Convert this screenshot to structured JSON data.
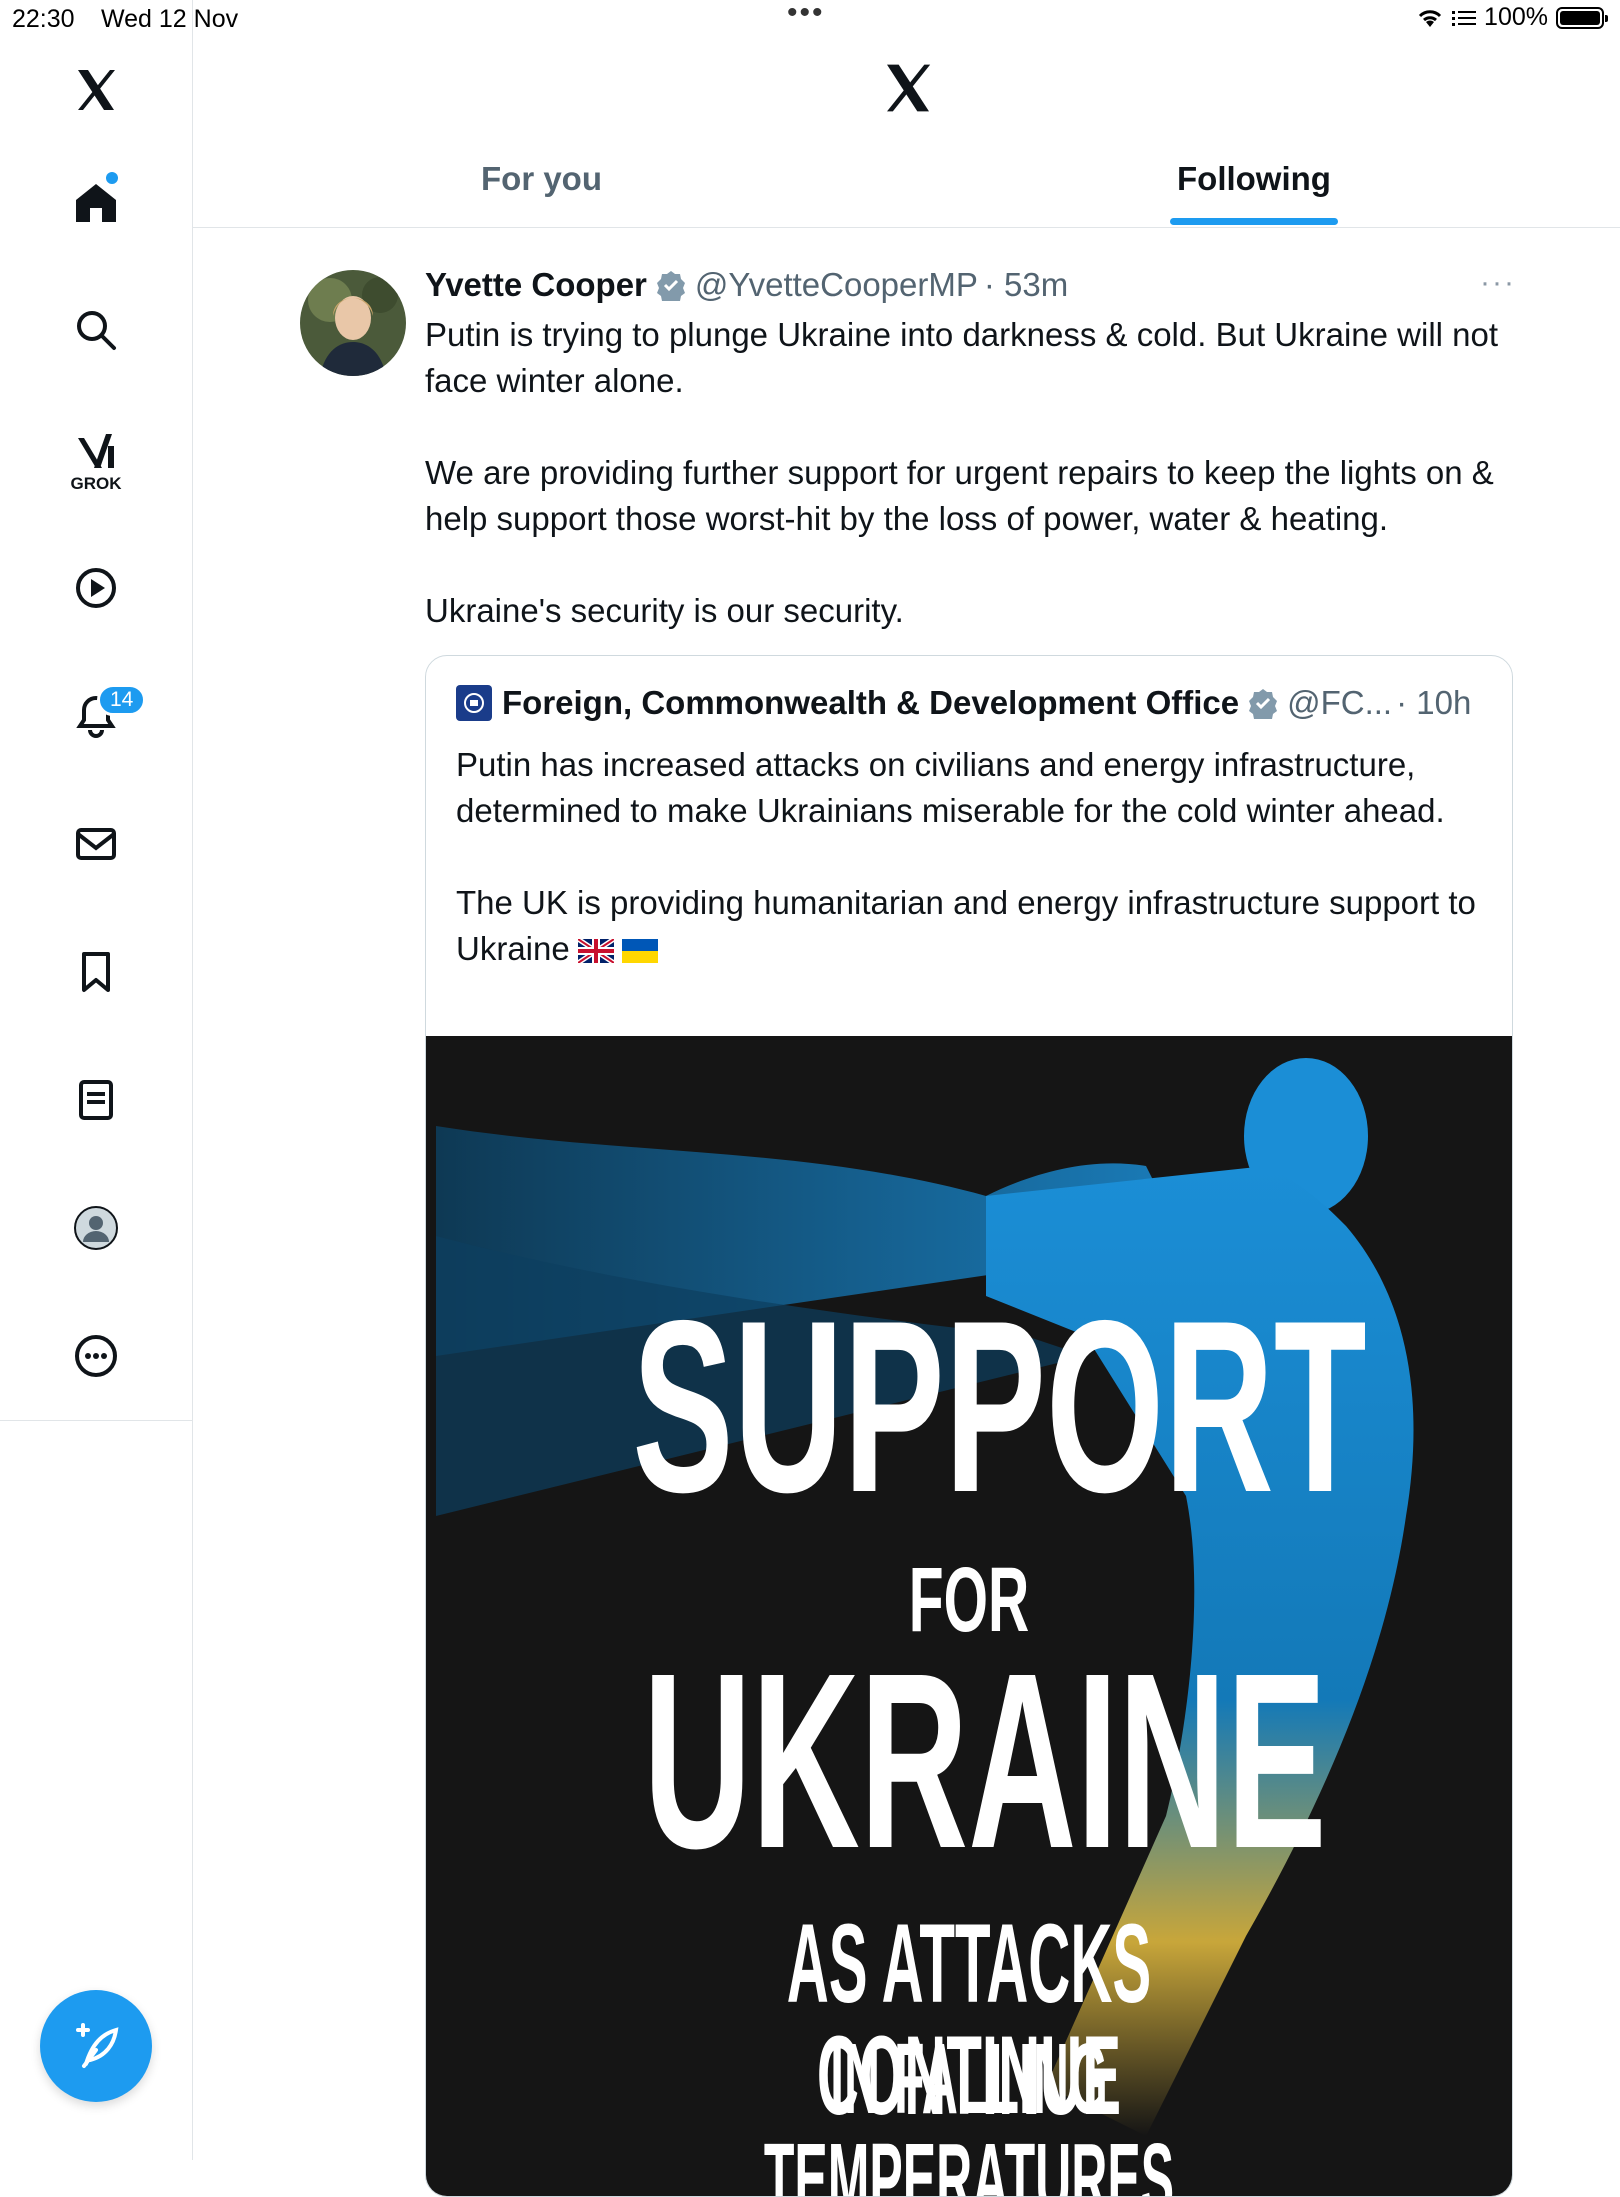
{
  "status_bar": {
    "time": "22:30",
    "date": "Wed 12 Nov",
    "battery": "100%"
  },
  "sidebar": {
    "items": [
      "x-logo",
      "home-icon",
      "search-icon",
      "grok-icon",
      "video-icon",
      "notifications-icon",
      "messages-icon",
      "bookmarks-icon",
      "lists-icon",
      "profile-icon",
      "more-icon"
    ],
    "grok_label": "GROK",
    "notifications_count": "14"
  },
  "tabs": {
    "for_you": "For you",
    "following": "Following",
    "active": "Following"
  },
  "tweet": {
    "name": "Yvette Cooper",
    "handle": "@YvetteCooperMP",
    "time": "· 53m",
    "text": [
      "Putin is trying to plunge Ukraine into darkness & cold. But Ukraine will not face winter alone.",
      "We are providing further support for urgent repairs to keep the lights on & help support those worst-hit by the loss of power, water & heating.",
      "Ukraine's security is our security."
    ],
    "more": "···"
  },
  "quote": {
    "name": "Foreign, Commonwealth & Development Office",
    "handle": "@FC...",
    "time": "· 10h",
    "text": [
      "Putin has increased attacks on civilians and energy infrastructure, determined to make Ukrainians miserable for the cold winter ahead.",
      "The UK is providing humanitarian and energy infrastructure support to Ukraine"
    ],
    "poster": {
      "line1": "SUPPORT",
      "line2": "FOR",
      "line3": "UKRAINE",
      "line4": "AS ATTACKS CONTINUE",
      "line5": "IN FALLING TEMPERATURES"
    }
  },
  "colors": {
    "accent": "#1d9bf0",
    "text_secondary": "#536471",
    "poster_bg": "#151515"
  }
}
